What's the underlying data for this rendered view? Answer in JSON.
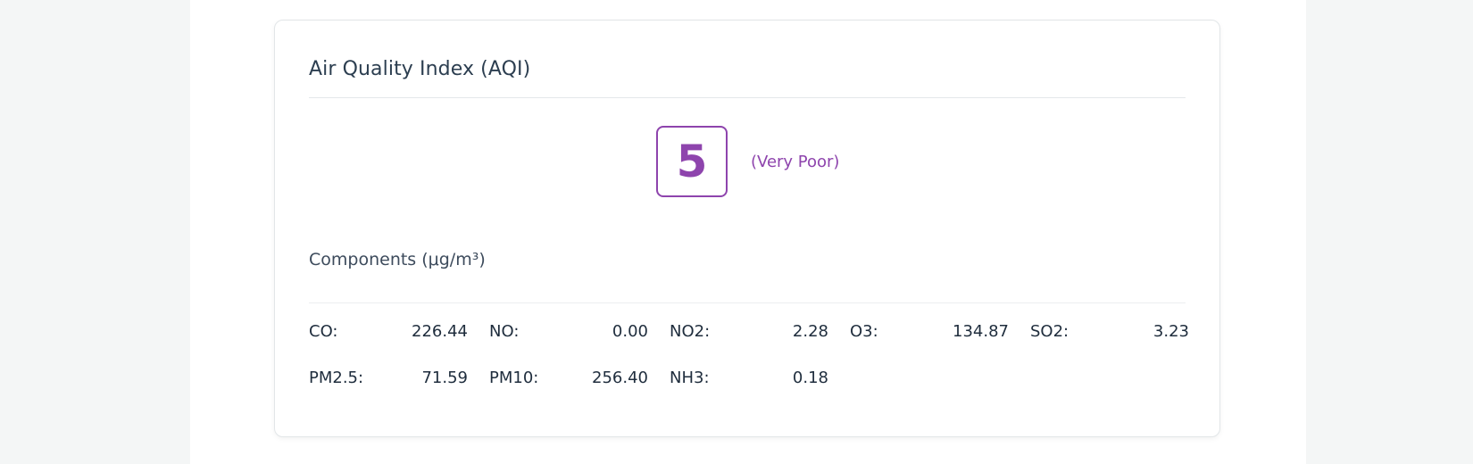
{
  "card": {
    "title": "Air Quality Index (AQI)"
  },
  "aqi": {
    "value": "5",
    "label": "(Very Poor)",
    "color": "#8e44ad"
  },
  "components": {
    "title": "Components (μg/m³)",
    "items": [
      {
        "name": "CO:",
        "value": "226.44"
      },
      {
        "name": "NO:",
        "value": "0.00"
      },
      {
        "name": "NO2:",
        "value": "2.28"
      },
      {
        "name": "O3:",
        "value": "134.87"
      },
      {
        "name": "SO2:",
        "value": "3.23"
      },
      {
        "name": "PM2.5:",
        "value": "71.59"
      },
      {
        "name": "PM10:",
        "value": "256.40"
      },
      {
        "name": "NH3:",
        "value": "0.18"
      }
    ]
  }
}
